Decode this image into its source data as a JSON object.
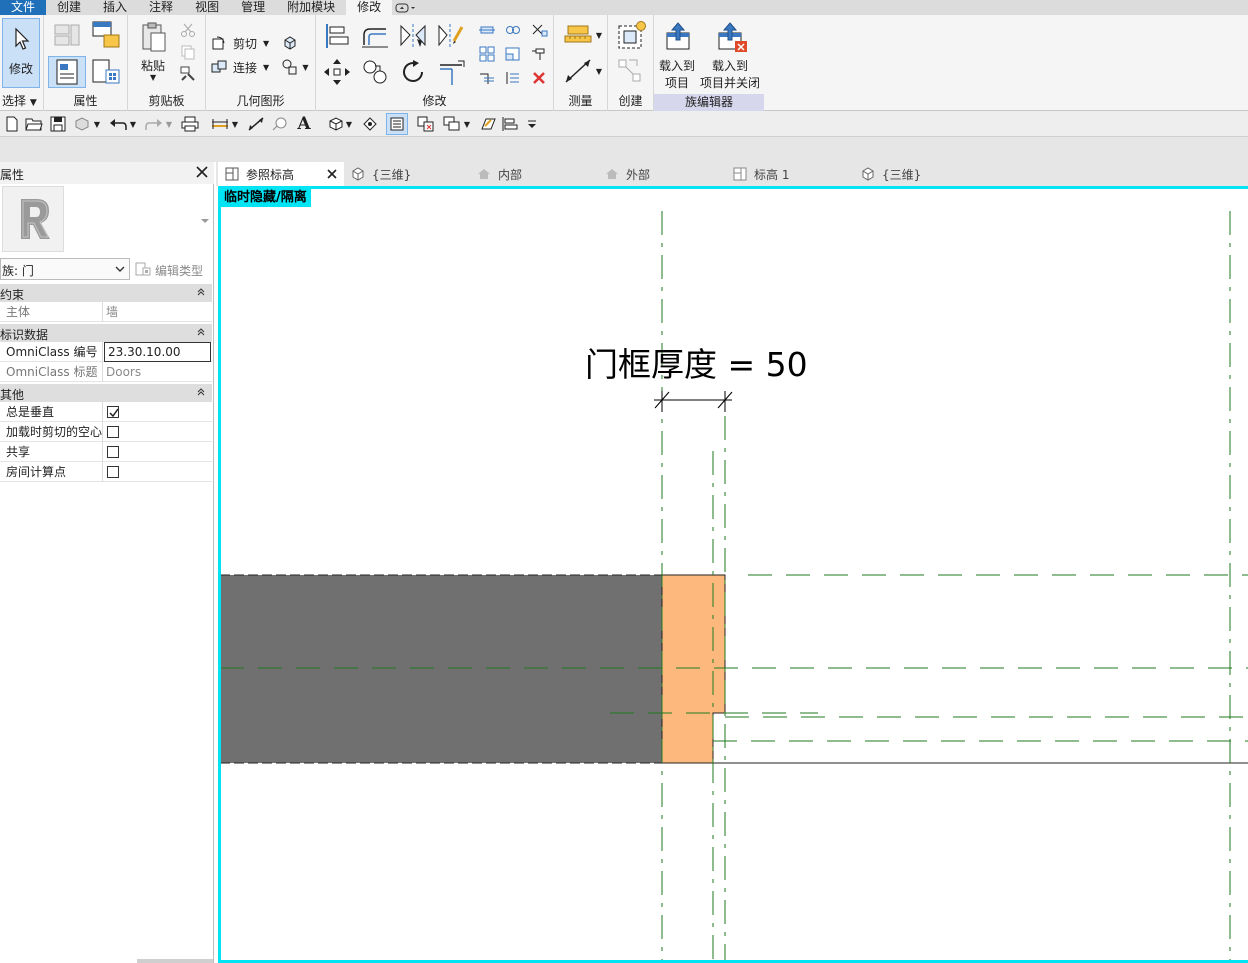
{
  "ribbon": {
    "tabs": [
      "文件",
      "创建",
      "插入",
      "注释",
      "视图",
      "管理",
      "附加模块",
      "修改"
    ],
    "groups": {
      "select": {
        "label": "选择",
        "modify": "修改"
      },
      "properties": {
        "label": "属性"
      },
      "clipboard": {
        "label": "剪贴板",
        "paste": "粘贴"
      },
      "geometry": {
        "label": "几何图形",
        "cut": "剪切",
        "join": "连接"
      },
      "modify": {
        "label": "修改"
      },
      "measure": {
        "label": "测量"
      },
      "create": {
        "label": "创建"
      },
      "family_editor": {
        "label": "族编辑器",
        "load_line1": "载入到",
        "load_line2": "项目",
        "load_close_line1": "载入到",
        "load_close_line2": "项目并关闭"
      }
    }
  },
  "properties_panel": {
    "title": "属性",
    "family": "族: 门",
    "edit_type": "编辑类型",
    "sections": [
      {
        "title": "约束",
        "rows": [
          {
            "label": "主体",
            "value": "墙"
          }
        ]
      },
      {
        "title": "标识数据",
        "rows": [
          {
            "label": "OmniClass 编号",
            "value": "23.30.10.00"
          },
          {
            "label": "OmniClass 标题",
            "value": "Doors"
          }
        ]
      },
      {
        "title": "其他",
        "rows": [
          {
            "label": "总是垂直",
            "checked": true
          },
          {
            "label": "加载时剪切的空心",
            "checked": false
          },
          {
            "label": "共享",
            "checked": false
          },
          {
            "label": "房间计算点",
            "checked": false
          }
        ]
      }
    ]
  },
  "view_tabs": [
    {
      "label": "参照标高",
      "icon": "floor-plan-icon",
      "active": true
    },
    {
      "label": "{三维}",
      "icon": "3d-view-icon",
      "active": false
    },
    {
      "label": "内部",
      "icon": "elevation-icon",
      "active": false
    },
    {
      "label": "外部",
      "icon": "elevation-icon",
      "active": false
    },
    {
      "label": "标高 1",
      "icon": "floor-plan-icon",
      "active": false
    },
    {
      "label": "{三维}",
      "icon": "3d-view-icon",
      "active": false
    }
  ],
  "canvas": {
    "mode_label": "临时隐藏/隔离",
    "dimension_label": "门框厚度 = 50"
  },
  "colors": {
    "file_tab": "#1f6fb9",
    "isolate_border": "#00e4f4",
    "wall_fill": "#707070",
    "frame_fill": "#fdb97d",
    "reference_line": "#1f7a1f"
  }
}
